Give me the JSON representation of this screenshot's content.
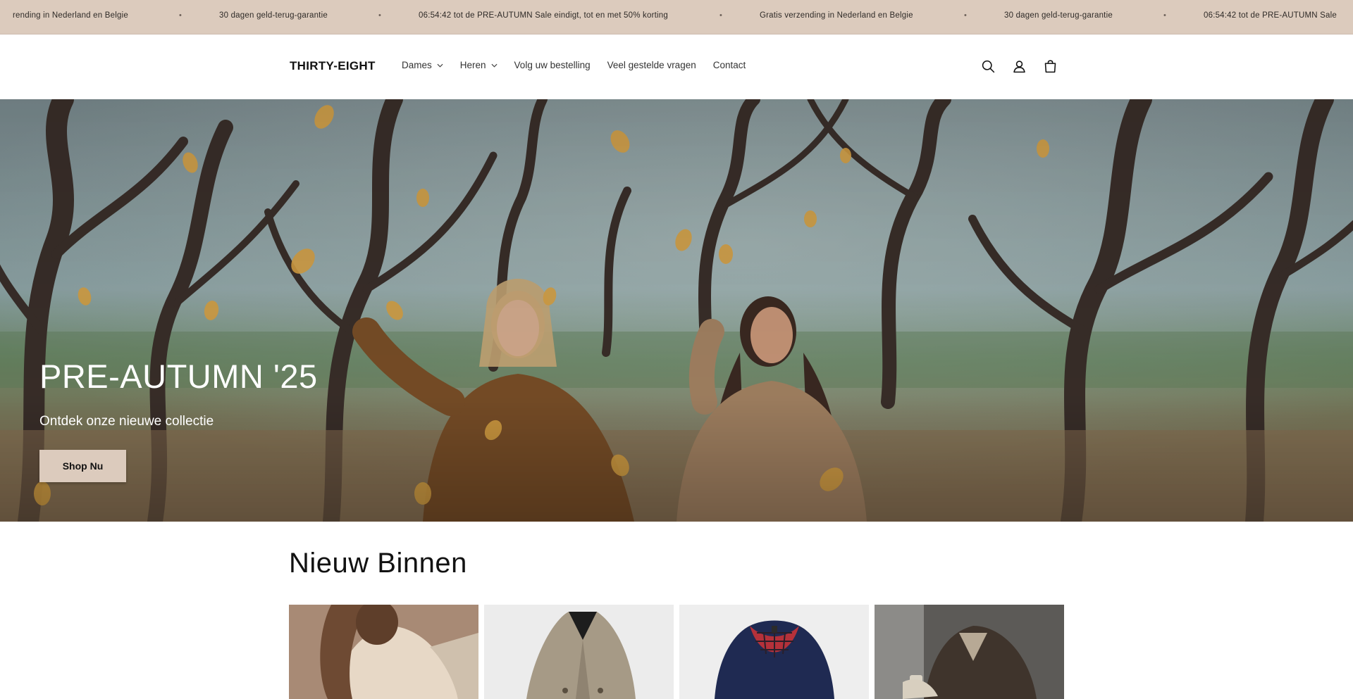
{
  "announcement": {
    "items": [
      "rending in Nederland en Belgie",
      "30 dagen geld-terug-garantie",
      "06:54:42 tot de PRE-AUTUMN Sale eindigt, tot en met 50% korting",
      "Gratis verzending in Nederland en Belgie",
      "30 dagen geld-terug-garantie",
      "06:54:42 tot de PRE-AUTUMN Sale"
    ],
    "separator": "•",
    "background": "#dccbbd"
  },
  "header": {
    "logo": "THIRTY-EIGHT",
    "nav": [
      {
        "label": "Dames",
        "has_dropdown": true
      },
      {
        "label": "Heren",
        "has_dropdown": true
      },
      {
        "label": "Volg uw bestelling",
        "has_dropdown": false
      },
      {
        "label": "Veel gestelde vragen",
        "has_dropdown": false
      },
      {
        "label": "Contact",
        "has_dropdown": false
      }
    ],
    "icons": [
      "search-icon",
      "account-icon",
      "cart-icon"
    ]
  },
  "hero": {
    "title": "PRE-AUTUMN '25",
    "subtitle": "Ontdek onze nieuwe collectie",
    "cta_label": "Shop Nu",
    "cta_color": "#dccbbd"
  },
  "new_arrivals": {
    "title": "Nieuw Binnen"
  }
}
